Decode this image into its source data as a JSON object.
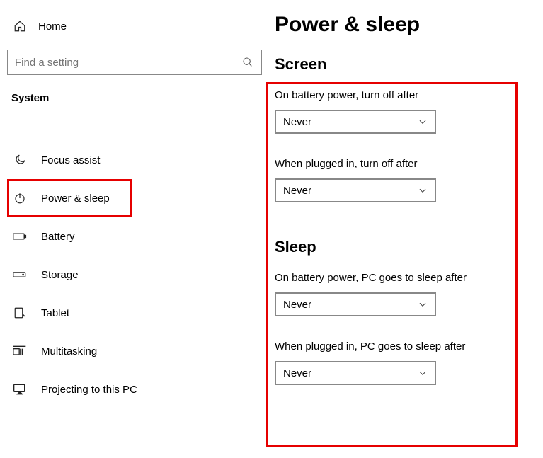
{
  "sidebar": {
    "home_label": "Home",
    "search_placeholder": "Find a setting",
    "section_title": "System",
    "items": [
      {
        "label": "Focus assist"
      },
      {
        "label": "Power & sleep"
      },
      {
        "label": "Battery"
      },
      {
        "label": "Storage"
      },
      {
        "label": "Tablet"
      },
      {
        "label": "Multitasking"
      },
      {
        "label": "Projecting to this PC"
      }
    ]
  },
  "main": {
    "page_title": "Power & sleep",
    "screen": {
      "title": "Screen",
      "battery_label": "On battery power, turn off after",
      "battery_value": "Never",
      "plugged_label": "When plugged in, turn off after",
      "plugged_value": "Never"
    },
    "sleep": {
      "title": "Sleep",
      "battery_label": "On battery power, PC goes to sleep after",
      "battery_value": "Never",
      "plugged_label": "When plugged in, PC goes to sleep after",
      "plugged_value": "Never"
    }
  }
}
